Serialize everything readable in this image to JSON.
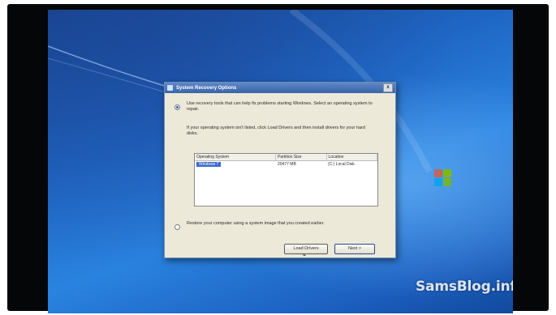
{
  "dialog": {
    "title": "System Recovery Options",
    "close_glyph": "x",
    "option1_text": "Use recovery tools that can help fix problems starting Windows. Select an operating system to repair.",
    "option1_note": "If your operating system isn't listed, click Load Drivers and then install drivers for your hard disks.",
    "columns": [
      "Operating System",
      "Partition Size",
      "Location"
    ],
    "rows": [
      {
        "os": "Windows 7",
        "size": "20477 MB",
        "location": "(C:) Local Disk"
      }
    ],
    "option2_text": "Restore your computer using a system image that you created earlier.",
    "load_drivers_label": "Load Drivers",
    "next_label": "Next >"
  },
  "watermark": "SamsBlog.info",
  "colors": {
    "desktop": "#1f66c4",
    "titlebar": "#3a63a8",
    "selection": "#3a6cc8",
    "dialog_bg": "#ece9d8"
  },
  "icons": [
    "windows-logo-icon",
    "mouse-cursor-icon",
    "close-icon",
    "window-icon"
  ]
}
